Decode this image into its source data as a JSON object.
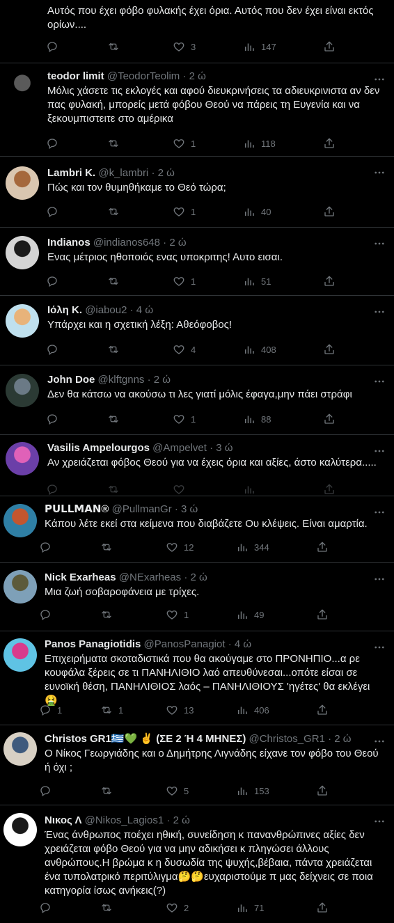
{
  "tweets": [
    {
      "name": "",
      "handle": "",
      "time": "",
      "text": "Αυτός που έχει φόβο φυλακής έχει όρια. Αυτός που δεν έχει είναι εκτός ορίων....",
      "replies": "",
      "retweets": "",
      "likes": "3",
      "views": "147",
      "avatar_colors": [
        "#3b3b3b",
        "#8a7a64"
      ]
    },
    {
      "name": "teodor limit",
      "handle": "@TeodorTeolim",
      "time": "· 2 ώ",
      "text": "Μόλις χάσετε τις εκλογές και αφού διευκρινήσεις τα αδιευκρινιστα αν δεν πας φυλακή, μπορείς μετά φόβου Θεού να πάρεις τη Ευγενία και να ξεκουμπιστειτε στο αμέρικα",
      "replies": "",
      "retweets": "",
      "likes": "1",
      "views": "118",
      "avatar_colors": [
        "#000000",
        "#5a5a5a"
      ]
    },
    {
      "name": "Lambri K.",
      "handle": "@k_lambri",
      "time": "· 2 ώ",
      "text": "Πώς και τον θυμηθήκαμε το Θεό τώρα;",
      "replies": "",
      "retweets": "",
      "likes": "1",
      "views": "40",
      "avatar_colors": [
        "#d9c6b0",
        "#a5683c"
      ]
    },
    {
      "name": "Indianos",
      "handle": "@indianos648",
      "time": "· 2 ώ",
      "text": "Ενας μέτριος ηθοποιός ενας υποκριτης! Αυτο εισαι.",
      "replies": "",
      "retweets": "",
      "likes": "1",
      "views": "51",
      "avatar_colors": [
        "#d4d4d4",
        "#1a1a1a"
      ]
    },
    {
      "name": "Ιόλη Κ.",
      "handle": "@iabou2",
      "time": "· 4 ώ",
      "text": "Υπάρχει και η σχετική λέξη: Αθεόφοβος!",
      "replies": "",
      "retweets": "",
      "likes": "4",
      "views": "408",
      "avatar_colors": [
        "#bfe0ee",
        "#e8b37a"
      ]
    },
    {
      "name": "John Doe",
      "handle": "@klftgnns",
      "time": "· 2 ώ",
      "text": "Δεν θα κάτσω να ακούσω τι λες γιατί μόλις έφαγα,μην πάει στράφι",
      "replies": "",
      "retweets": "",
      "likes": "1",
      "views": "88",
      "avatar_colors": [
        "#2b3a34",
        "#6b7a86"
      ]
    },
    {
      "name": "Vasilis Ampelourgos",
      "handle": "@Ampelvet",
      "time": "· 3 ώ",
      "text": "Αν χρειάζεται φόβος Θεού για να έχεις όρια και αξίες, άστο καλύτερα.....",
      "replies": "",
      "retweets": "",
      "likes": "",
      "views": "",
      "avatar_colors": [
        "#6b3fa8",
        "#e061b8"
      ]
    },
    {
      "name": "𝗣𝗨𝗟𝗟𝗠𝗔𝗡®",
      "handle": "@PullmanGr",
      "time": "· 3 ώ",
      "text": "Κάπου λέτε εκεί στα κείμενα που διαβάζετε Ου κλέψεις. Είναι αμαρτία.",
      "replies": "",
      "retweets": "",
      "likes": "12",
      "views": "344",
      "avatar_colors": [
        "#2f7fa5",
        "#c3562f"
      ]
    },
    {
      "name": "Nick Exarheas",
      "handle": "@NExarheas",
      "time": "· 2 ώ",
      "text": "Μια ζωή σοβαροφάνεια με τρίχες.",
      "replies": "",
      "retweets": "",
      "likes": "1",
      "views": "49",
      "avatar_colors": [
        "#7ea0b8",
        "#5c5a3a"
      ]
    },
    {
      "name": "Panos Panagiotidis",
      "handle": "@PanosPanagiot",
      "time": "· 4 ώ",
      "text": "Επιχειρήματα σκοταδιστικά που θα ακούγαμε στο ΠΡΟΝΗΠΙΟ...α ρε κουφάλα ξέρεις σε τι ΠΑΝΗΛΙΘΙΟ λαό απευθύνεσαι...οπότε είσαι σε ευνοϊκή θέση, ΠΑΝΗΛΙΘΙΟΣ λαός – ΠΑΝΗΛΙΘΙΟΥΣ 'ηγέτες' θα εκλέγει 🤮",
      "replies": "1",
      "retweets": "1",
      "likes": "13",
      "views": "406",
      "avatar_colors": [
        "#5fc3e4",
        "#d83a8c"
      ]
    },
    {
      "name": "Christos GR1🇬🇷💚 ✌️ (ΣΕ 2 Ή 4 ΜΗΝΕΣ)",
      "handle": "@Christos_GR1",
      "time": "· 2 ώ",
      "text": "Ο Νίκος Γεωργιάδης και ο Δημήτρης Λιγνάδης είχανε τον φόβο του Θεού ή όχι ;",
      "replies": "",
      "retweets": "",
      "likes": "5",
      "views": "153",
      "avatar_colors": [
        "#d8d0c4",
        "#3f5a7d"
      ]
    },
    {
      "name": "Νικος Λ",
      "handle": "@Nikos_Lagios1",
      "time": "· 2 ώ",
      "text": "Ένας άνθρωπος ποέχει ηθική, συνείδηση κ πανανθρώπινες αξίες δεν χρειάζεται φόβο Θεού για να μην αδικήσει κ πληγώσει άλλους ανθρώπους.Η βρώμα κ η δυσωδία της ψυχής,βέβαια, πάντα χρειάζεται ένα τυπολατρικό περιτύλιγμα🤔🤔ευχαριστούμε π μας δείχνεις σε ποια κατηγορία ίσως ανήκεις(?)",
      "replies": "",
      "retweets": "",
      "likes": "2",
      "views": "71",
      "avatar_colors": [
        "#ffffff",
        "#1a1a1a"
      ]
    }
  ]
}
